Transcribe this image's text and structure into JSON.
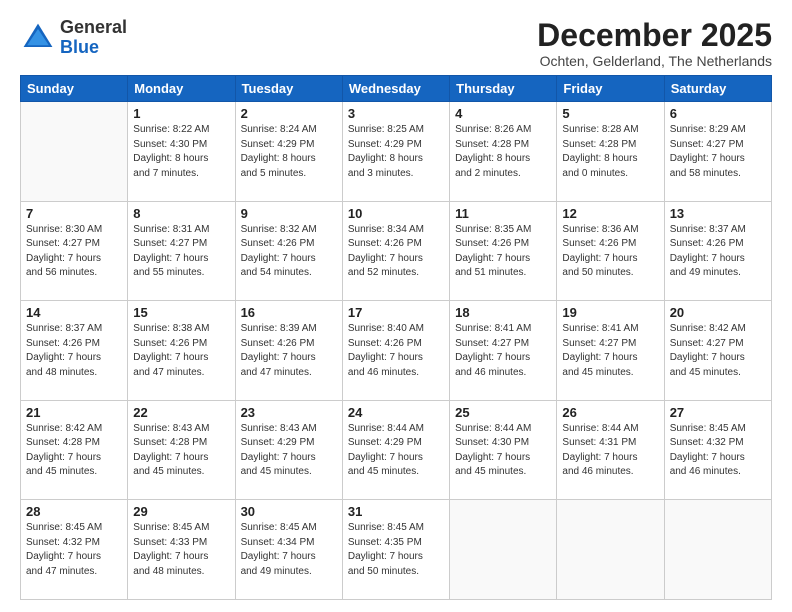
{
  "logo": {
    "general": "General",
    "blue": "Blue"
  },
  "header": {
    "month": "December 2025",
    "location": "Ochten, Gelderland, The Netherlands"
  },
  "weekdays": [
    "Sunday",
    "Monday",
    "Tuesday",
    "Wednesday",
    "Thursday",
    "Friday",
    "Saturday"
  ],
  "weeks": [
    [
      {
        "day": "",
        "info": ""
      },
      {
        "day": "1",
        "info": "Sunrise: 8:22 AM\nSunset: 4:30 PM\nDaylight: 8 hours\nand 7 minutes."
      },
      {
        "day": "2",
        "info": "Sunrise: 8:24 AM\nSunset: 4:29 PM\nDaylight: 8 hours\nand 5 minutes."
      },
      {
        "day": "3",
        "info": "Sunrise: 8:25 AM\nSunset: 4:29 PM\nDaylight: 8 hours\nand 3 minutes."
      },
      {
        "day": "4",
        "info": "Sunrise: 8:26 AM\nSunset: 4:28 PM\nDaylight: 8 hours\nand 2 minutes."
      },
      {
        "day": "5",
        "info": "Sunrise: 8:28 AM\nSunset: 4:28 PM\nDaylight: 8 hours\nand 0 minutes."
      },
      {
        "day": "6",
        "info": "Sunrise: 8:29 AM\nSunset: 4:27 PM\nDaylight: 7 hours\nand 58 minutes."
      }
    ],
    [
      {
        "day": "7",
        "info": "Sunrise: 8:30 AM\nSunset: 4:27 PM\nDaylight: 7 hours\nand 56 minutes."
      },
      {
        "day": "8",
        "info": "Sunrise: 8:31 AM\nSunset: 4:27 PM\nDaylight: 7 hours\nand 55 minutes."
      },
      {
        "day": "9",
        "info": "Sunrise: 8:32 AM\nSunset: 4:26 PM\nDaylight: 7 hours\nand 54 minutes."
      },
      {
        "day": "10",
        "info": "Sunrise: 8:34 AM\nSunset: 4:26 PM\nDaylight: 7 hours\nand 52 minutes."
      },
      {
        "day": "11",
        "info": "Sunrise: 8:35 AM\nSunset: 4:26 PM\nDaylight: 7 hours\nand 51 minutes."
      },
      {
        "day": "12",
        "info": "Sunrise: 8:36 AM\nSunset: 4:26 PM\nDaylight: 7 hours\nand 50 minutes."
      },
      {
        "day": "13",
        "info": "Sunrise: 8:37 AM\nSunset: 4:26 PM\nDaylight: 7 hours\nand 49 minutes."
      }
    ],
    [
      {
        "day": "14",
        "info": "Sunrise: 8:37 AM\nSunset: 4:26 PM\nDaylight: 7 hours\nand 48 minutes."
      },
      {
        "day": "15",
        "info": "Sunrise: 8:38 AM\nSunset: 4:26 PM\nDaylight: 7 hours\nand 47 minutes."
      },
      {
        "day": "16",
        "info": "Sunrise: 8:39 AM\nSunset: 4:26 PM\nDaylight: 7 hours\nand 47 minutes."
      },
      {
        "day": "17",
        "info": "Sunrise: 8:40 AM\nSunset: 4:26 PM\nDaylight: 7 hours\nand 46 minutes."
      },
      {
        "day": "18",
        "info": "Sunrise: 8:41 AM\nSunset: 4:27 PM\nDaylight: 7 hours\nand 46 minutes."
      },
      {
        "day": "19",
        "info": "Sunrise: 8:41 AM\nSunset: 4:27 PM\nDaylight: 7 hours\nand 45 minutes."
      },
      {
        "day": "20",
        "info": "Sunrise: 8:42 AM\nSunset: 4:27 PM\nDaylight: 7 hours\nand 45 minutes."
      }
    ],
    [
      {
        "day": "21",
        "info": "Sunrise: 8:42 AM\nSunset: 4:28 PM\nDaylight: 7 hours\nand 45 minutes."
      },
      {
        "day": "22",
        "info": "Sunrise: 8:43 AM\nSunset: 4:28 PM\nDaylight: 7 hours\nand 45 minutes."
      },
      {
        "day": "23",
        "info": "Sunrise: 8:43 AM\nSunset: 4:29 PM\nDaylight: 7 hours\nand 45 minutes."
      },
      {
        "day": "24",
        "info": "Sunrise: 8:44 AM\nSunset: 4:29 PM\nDaylight: 7 hours\nand 45 minutes."
      },
      {
        "day": "25",
        "info": "Sunrise: 8:44 AM\nSunset: 4:30 PM\nDaylight: 7 hours\nand 45 minutes."
      },
      {
        "day": "26",
        "info": "Sunrise: 8:44 AM\nSunset: 4:31 PM\nDaylight: 7 hours\nand 46 minutes."
      },
      {
        "day": "27",
        "info": "Sunrise: 8:45 AM\nSunset: 4:32 PM\nDaylight: 7 hours\nand 46 minutes."
      }
    ],
    [
      {
        "day": "28",
        "info": "Sunrise: 8:45 AM\nSunset: 4:32 PM\nDaylight: 7 hours\nand 47 minutes."
      },
      {
        "day": "29",
        "info": "Sunrise: 8:45 AM\nSunset: 4:33 PM\nDaylight: 7 hours\nand 48 minutes."
      },
      {
        "day": "30",
        "info": "Sunrise: 8:45 AM\nSunset: 4:34 PM\nDaylight: 7 hours\nand 49 minutes."
      },
      {
        "day": "31",
        "info": "Sunrise: 8:45 AM\nSunset: 4:35 PM\nDaylight: 7 hours\nand 50 minutes."
      },
      {
        "day": "",
        "info": ""
      },
      {
        "day": "",
        "info": ""
      },
      {
        "day": "",
        "info": ""
      }
    ]
  ]
}
